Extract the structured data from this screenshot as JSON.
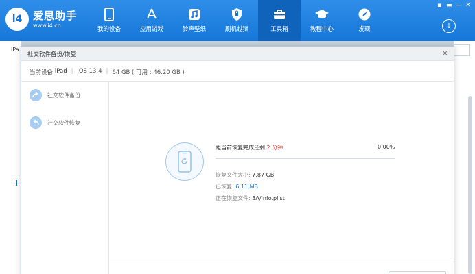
{
  "app": {
    "logo_text": "i4",
    "name": "爱思助手",
    "url": "www.i4.cn"
  },
  "nav": [
    {
      "label": "我的设备",
      "icon": "phone-icon",
      "active": false
    },
    {
      "label": "应用游戏",
      "icon": "app-store-icon",
      "active": false
    },
    {
      "label": "铃声壁纸",
      "icon": "music-note-icon",
      "active": false
    },
    {
      "label": "刷机越狱",
      "icon": "shield-icon",
      "active": false
    },
    {
      "label": "工具箱",
      "icon": "toolbox-icon",
      "active": true
    },
    {
      "label": "教程中心",
      "icon": "graduation-cap-icon",
      "active": false
    },
    {
      "label": "发现",
      "icon": "compass-icon",
      "active": false
    }
  ],
  "window_controls": {
    "skin": "▪",
    "menu": "▬",
    "minimize": "—",
    "close": "✕"
  },
  "background": {
    "device_tab": "iPa"
  },
  "dialog": {
    "title": "社交软件备份/恢复",
    "close": "×",
    "device": {
      "prefix": "当前设备: ",
      "name": "iPad",
      "ios": "iOS 13.4",
      "storage": "64 GB  ( 可用 : 46.20 GB )"
    },
    "sidebar": [
      {
        "label": "社交软件备份",
        "icon": "backup-arrow-icon"
      },
      {
        "label": "社交软件恢复",
        "icon": "restore-arrow-icon"
      }
    ],
    "progress": {
      "label_prefix": "距当前恢复完成还剩 ",
      "remaining": "2 分钟",
      "percent_text": "0.00%",
      "percent_value": 0
    },
    "details": [
      {
        "label": "恢复文件大小: ",
        "value": "7.87 GB",
        "color": "#333333"
      },
      {
        "label": "已恢复:  ",
        "value": "6.11 MB",
        "color": "#1677d9"
      },
      {
        "label": "正在恢复文件: ",
        "value": "3A/Info.plist",
        "color": "#333333"
      }
    ]
  },
  "colors": {
    "accent": "#1677d9",
    "warning": "#e23b30"
  }
}
